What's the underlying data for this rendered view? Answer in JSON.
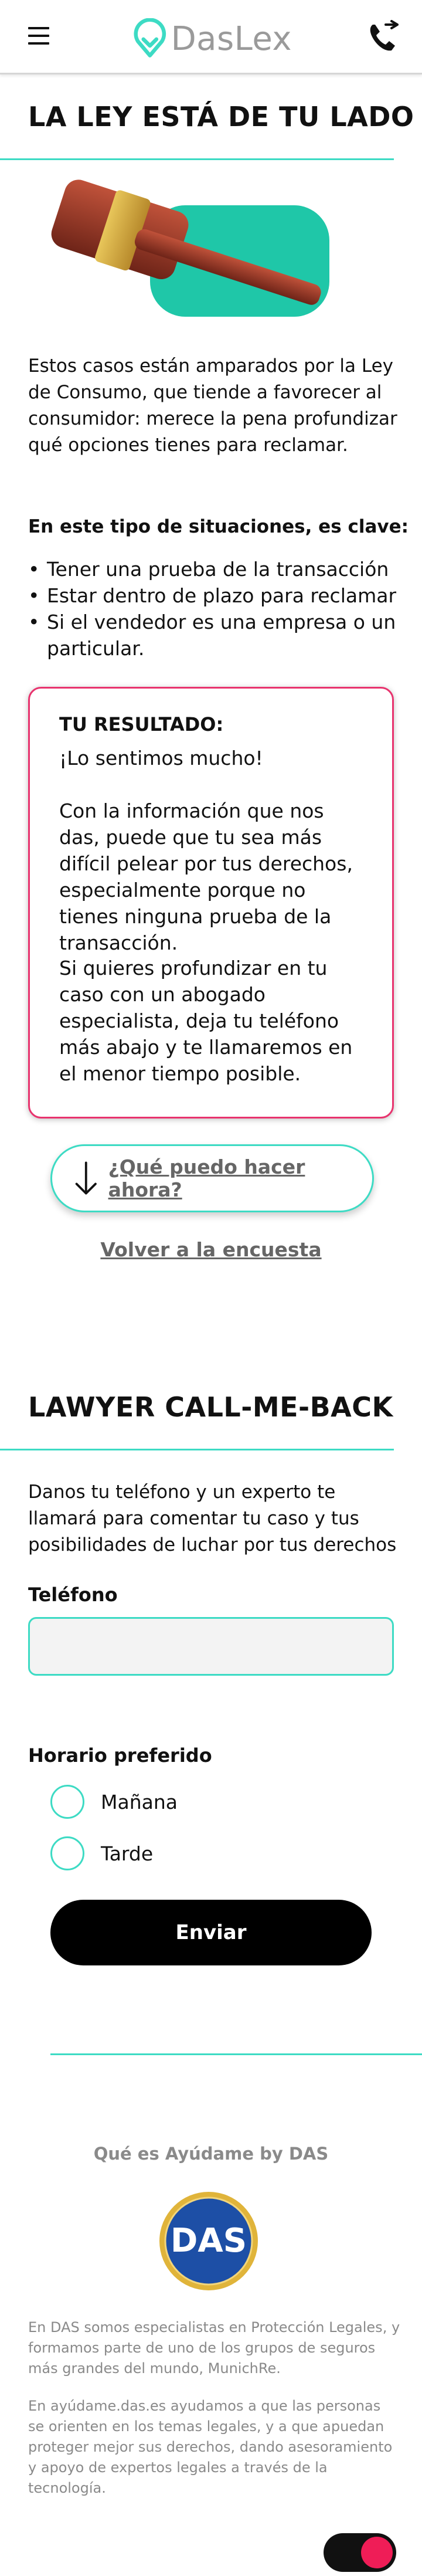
{
  "header": {
    "brand": "DasLex",
    "icons": {
      "menu": "hamburger-menu-icon",
      "logo": "daslex-pin-icon",
      "call": "phone-icon"
    }
  },
  "hero": {
    "title": "LA LEY ESTÁ DE TU LADO",
    "intro": "Estos casos están amparados por la Ley de Consumo, que tiende a favorecer al consumidor: merece la pena profundizar qué opciones tienes para reclamar."
  },
  "key_points": {
    "heading": "En este tipo de situaciones, es clave:",
    "items": [
      "Tener una prueba de la transacción",
      "Estar dentro de plazo para reclamar",
      "Si el vendedor es una empresa o un particular."
    ]
  },
  "result": {
    "title": "TU RESULTADO:",
    "p1": "¡Lo sentimos mucho!",
    "p2": "Con la información que nos das, puede que tu sea más difícil pelear por tus derechos, especialmente porque no tienes ninguna prueba de la transacción.",
    "p3": "Si quieres profundizar en tu caso con un abogado especialista, deja tu teléfono más abajo y te llamaremos en el menor tiempo posible."
  },
  "actions": {
    "what_now": "¿Qué puedo hacer ahora?",
    "back": "Volver a la encuesta"
  },
  "callback": {
    "title": "LAWYER CALL-ME-BACK",
    "description": "Danos tu teléfono y un experto te llamará para comentar tu caso y tus posibilidades de luchar por tus derechos",
    "phone_label": "Teléfono",
    "phone_value": "",
    "phone_placeholder": "",
    "schedule_label": "Horario preferido",
    "options": [
      "Mañana",
      "Tarde"
    ],
    "submit": "Enviar"
  },
  "footer": {
    "title": "Qué es Ayúdame by DAS",
    "logo_text": "DAS",
    "p1": "En DAS somos especialistas en Protección Legales, y formamos parte de uno de los grupos de seguros más grandes del mundo, MunichRe.",
    "p2": "En ayúdame.das.es ayudamos a que las personas se orienten en los temas legales, y a que apuedan proteger mejor sus derechos, dando asesoramiento y apoyo de expertos legales a través de la tecnología."
  },
  "colors": {
    "accent": "#3ddbc4",
    "alert": "#e8336e",
    "toggle_knob": "#ef1d57",
    "muted": "#8a8a8a"
  }
}
